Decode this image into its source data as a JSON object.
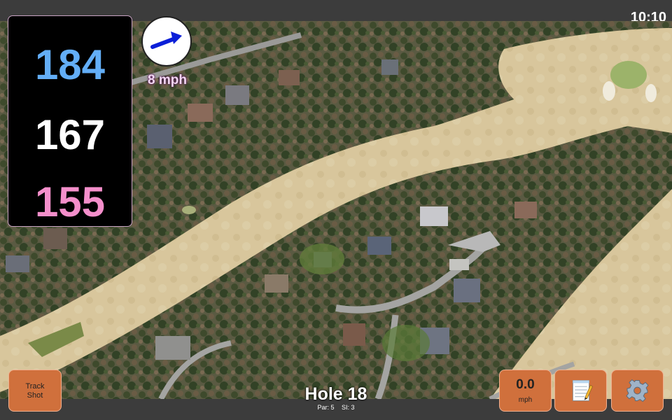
{
  "status_bar": {
    "time": "10:10"
  },
  "distances": {
    "back": "184",
    "center": "167",
    "front": "155"
  },
  "wind": {
    "speed": "8 mph",
    "direction_icon": "arrow-icon"
  },
  "buttons": {
    "track_shot": "Track Shot",
    "speed_value": "0.0",
    "speed_unit": "mph",
    "notes_icon": "notepad-icon",
    "settings_icon": "gear-icon"
  },
  "hole": {
    "title": "Hole 18",
    "par": "Par: 5",
    "si": "SI: 3"
  },
  "colors": {
    "back_distance": "#63aef7",
    "center_distance": "#ffffff",
    "front_distance": "#f48fcb",
    "button_bg": "#d0703c",
    "fairway": "#d9c79d",
    "trees": "#4f5a3a"
  }
}
